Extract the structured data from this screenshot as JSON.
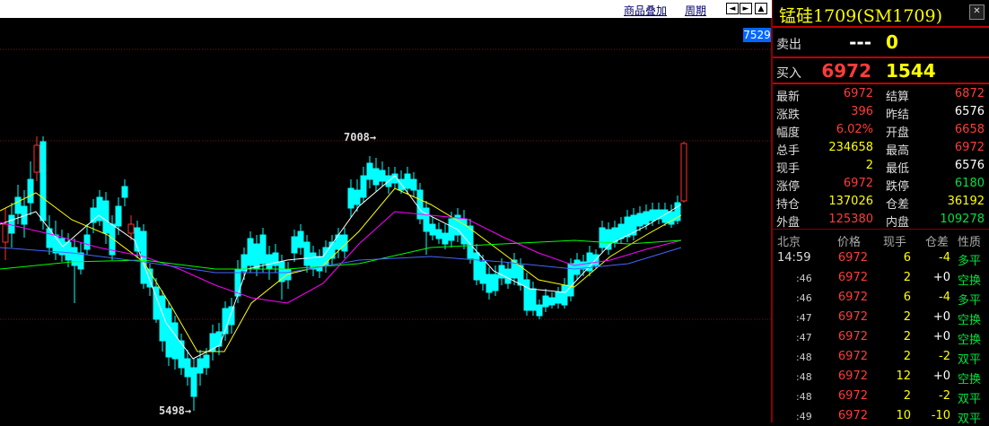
{
  "toolbar": {
    "overlay_label": "商品叠加",
    "period_label": "周期"
  },
  "chart": {
    "current_price_tag": "7529",
    "high_mark": "7008",
    "low_mark": "5498",
    "colors": {
      "up": "#ff3030",
      "down": "#00ffff",
      "ma1": "#ffffff",
      "ma2": "#ffff00",
      "ma3": "#ff00ff",
      "ma4": "#00ff00",
      "ma5": "#4466ff"
    }
  },
  "quote": {
    "title": "锰硅1709(SM1709)",
    "sell_label": "卖出",
    "sell_price": "---",
    "sell_vol": "0",
    "buy_label": "买入",
    "buy_price": "6972",
    "buy_vol": "1544",
    "rows": [
      {
        "l1": "最新",
        "v1": "6972",
        "c1": "#ff3b3b",
        "l2": "结算",
        "v2": "6872",
        "c2": "#ff3b3b"
      },
      {
        "l1": "涨跌",
        "v1": "396",
        "c1": "#ff3b3b",
        "l2": "昨结",
        "v2": "6576",
        "c2": "#ffffff"
      },
      {
        "l1": "幅度",
        "v1": "6.02%",
        "c1": "#ff3b3b",
        "l2": "开盘",
        "v2": "6658",
        "c2": "#ff3b3b"
      },
      {
        "l1": "总手",
        "v1": "234658",
        "c1": "#ffff00",
        "l2": "最高",
        "v2": "6972",
        "c2": "#ff3b3b"
      },
      {
        "l1": "现手",
        "v1": "2",
        "c1": "#ffff00",
        "l2": "最低",
        "v2": "6576",
        "c2": "#ffffff"
      },
      {
        "l1": "涨停",
        "v1": "6972",
        "c1": "#ff3b3b",
        "l2": "跌停",
        "v2": "6180",
        "c2": "#00e040"
      },
      {
        "l1": "持仓",
        "v1": "137026",
        "c1": "#ffff00",
        "l2": "仓差",
        "v2": "36192",
        "c2": "#ffff00"
      },
      {
        "l1": "外盘",
        "v1": "125380",
        "c1": "#ff3b3b",
        "l2": "内盘",
        "v2": "109278",
        "c2": "#00e040"
      }
    ]
  },
  "ticks": {
    "headers": {
      "time": "北京",
      "price": "价格",
      "vol": "现手",
      "oi": "仓差",
      "nature": "性质"
    },
    "rows": [
      {
        "time": "14:59",
        "price": "6972",
        "vol": "6",
        "oi": "-4",
        "oi_color": "#ffff00",
        "nature": "多平"
      },
      {
        "time": ":46",
        "price": "6972",
        "vol": "2",
        "oi": "+0",
        "oi_color": "#ffffff",
        "nature": "空换"
      },
      {
        "time": ":46",
        "price": "6972",
        "vol": "6",
        "oi": "-4",
        "oi_color": "#ffff00",
        "nature": "多平"
      },
      {
        "time": ":47",
        "price": "6972",
        "vol": "2",
        "oi": "+0",
        "oi_color": "#ffffff",
        "nature": "空换"
      },
      {
        "time": ":47",
        "price": "6972",
        "vol": "2",
        "oi": "+0",
        "oi_color": "#ffffff",
        "nature": "空换"
      },
      {
        "time": ":48",
        "price": "6972",
        "vol": "2",
        "oi": "-2",
        "oi_color": "#ffff00",
        "nature": "双平"
      },
      {
        "time": ":48",
        "price": "6972",
        "vol": "12",
        "oi": "+0",
        "oi_color": "#ffffff",
        "nature": "空换"
      },
      {
        "time": ":48",
        "price": "6972",
        "vol": "2",
        "oi": "-2",
        "oi_color": "#ffff00",
        "nature": "双平"
      },
      {
        "time": ":49",
        "price": "6972",
        "vol": "10",
        "oi": "-10",
        "oi_color": "#ffff00",
        "nature": "双平"
      }
    ]
  }
}
